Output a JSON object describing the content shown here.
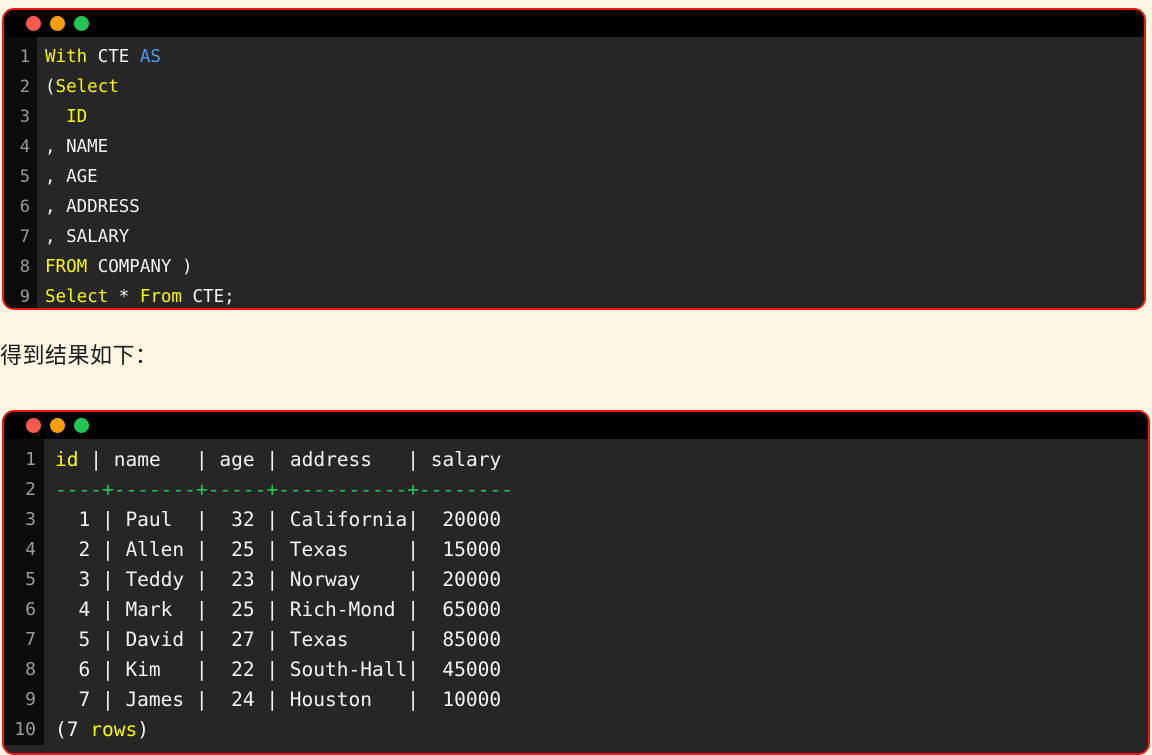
{
  "page": {
    "background_color": "#fdf6e3"
  },
  "sql_block": {
    "window_controls": {
      "close_color": "#fb5a4f",
      "minimize_color": "#f79d0e",
      "maximize_color": "#22c455"
    },
    "border_color": "#f4180d",
    "gutter_numbers": [
      "1",
      "2",
      "3",
      "4",
      "5",
      "6",
      "7",
      "8",
      "9"
    ],
    "lines": [
      [
        {
          "t": "With",
          "c": "kw"
        },
        {
          "t": " ",
          "c": "plain"
        },
        {
          "t": "CTE",
          "c": "plain"
        },
        {
          "t": " ",
          "c": "plain"
        },
        {
          "t": "AS",
          "c": "type"
        }
      ],
      [
        {
          "t": "(",
          "c": "plain"
        },
        {
          "t": "Select",
          "c": "kw"
        }
      ],
      [
        {
          "t": "  ",
          "c": "plain"
        },
        {
          "t": "ID",
          "c": "kw"
        }
      ],
      [
        {
          "t": ", ",
          "c": "plain"
        },
        {
          "t": "NAME",
          "c": "plain"
        }
      ],
      [
        {
          "t": ", ",
          "c": "plain"
        },
        {
          "t": "AGE",
          "c": "plain"
        }
      ],
      [
        {
          "t": ", ",
          "c": "plain"
        },
        {
          "t": "ADDRESS",
          "c": "plain"
        }
      ],
      [
        {
          "t": ", ",
          "c": "plain"
        },
        {
          "t": "SALARY",
          "c": "plain"
        }
      ],
      [
        {
          "t": "FROM",
          "c": "kw"
        },
        {
          "t": " COMPANY )",
          "c": "plain"
        }
      ],
      [
        {
          "t": "Select",
          "c": "kw"
        },
        {
          "t": " * ",
          "c": "plain"
        },
        {
          "t": "From",
          "c": "kw"
        },
        {
          "t": " CTE;",
          "c": "plain"
        }
      ]
    ],
    "plain_text": "With CTE AS\n(Select\n  ID\n, NAME\n, AGE\n, ADDRESS\n, SALARY\nFROM COMPANY )\nSelect * From CTE;"
  },
  "prose": {
    "result_caption": "得到结果如下："
  },
  "result_block": {
    "window_controls": {
      "close_color": "#fb5a4f",
      "minimize_color": "#f79d0e",
      "maximize_color": "#22c455"
    },
    "border_color": "#f4180d",
    "gutter_numbers": [
      "1",
      "2",
      "3",
      "4",
      "5",
      "6",
      "7",
      "8",
      "9",
      "10"
    ],
    "lines": [
      [
        {
          "t": "id",
          "c": "kw"
        },
        {
          "t": " | ",
          "c": "pipe"
        },
        {
          "t": "name",
          "c": "plain"
        },
        {
          "t": "   | ",
          "c": "pipe"
        },
        {
          "t": "age",
          "c": "plain"
        },
        {
          "t": " | ",
          "c": "pipe"
        },
        {
          "t": "address",
          "c": "plain"
        },
        {
          "t": "   | ",
          "c": "pipe"
        },
        {
          "t": "salary",
          "c": "plain"
        }
      ],
      [
        {
          "t": "----+-------+-----+-----------+--------",
          "c": "rule"
        }
      ],
      [
        {
          "t": "  1 | Paul  |  32 | California|  20000",
          "c": "plain"
        }
      ],
      [
        {
          "t": "  2 | Allen |  25 | Texas     |  15000",
          "c": "plain"
        }
      ],
      [
        {
          "t": "  3 | Teddy |  23 | Norway    |  20000",
          "c": "plain"
        }
      ],
      [
        {
          "t": "  4 | Mark  |  25 | Rich-Mond |  65000",
          "c": "plain"
        }
      ],
      [
        {
          "t": "  5 | David |  27 | Texas     |  85000",
          "c": "plain"
        }
      ],
      [
        {
          "t": "  6 | Kim   |  22 | South-Hall|  45000",
          "c": "plain"
        }
      ],
      [
        {
          "t": "  7 | James |  24 | Houston   |  10000",
          "c": "plain"
        }
      ],
      [
        {
          "t": "(7 ",
          "c": "plain"
        },
        {
          "t": "rows",
          "c": "kw"
        },
        {
          "t": ")",
          "c": "plain"
        }
      ]
    ],
    "table": {
      "columns": [
        "id",
        "name",
        "age",
        "address",
        "salary"
      ],
      "rows": [
        [
          "1",
          "Paul",
          "32",
          "California",
          "20000"
        ],
        [
          "2",
          "Allen",
          "25",
          "Texas",
          "15000"
        ],
        [
          "3",
          "Teddy",
          "23",
          "Norway",
          "20000"
        ],
        [
          "4",
          "Mark",
          "25",
          "Rich-Mond",
          "65000"
        ],
        [
          "5",
          "David",
          "27",
          "Texas",
          "85000"
        ],
        [
          "6",
          "Kim",
          "22",
          "South-Hall",
          "45000"
        ],
        [
          "7",
          "James",
          "24",
          "Houston",
          "10000"
        ]
      ],
      "row_count_label": "(7 rows)"
    }
  }
}
